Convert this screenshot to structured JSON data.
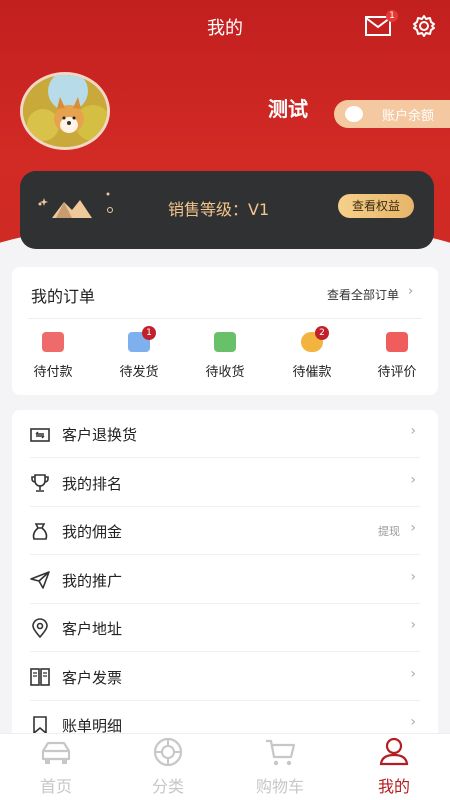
{
  "header": {
    "title": "我的",
    "mail_badge": "1",
    "username": "测试",
    "balance_label": "账户余额"
  },
  "level": {
    "text": "销售等级：V1",
    "benefits_button": "查看权益"
  },
  "orders": {
    "title": "我的订单",
    "view_all": "查看全部订单",
    "items": [
      {
        "label": "待付款",
        "badge": "",
        "color": "#ef6a6a",
        "icon": "payment-icon"
      },
      {
        "label": "待发货",
        "badge": "1",
        "color": "#7fb0ee",
        "icon": "shipping-box-icon"
      },
      {
        "label": "待收货",
        "badge": "",
        "color": "#69c06a",
        "icon": "truck-icon"
      },
      {
        "label": "待催款",
        "badge": "2",
        "color": "#f3b33f",
        "icon": "yen-coin-icon"
      },
      {
        "label": "待评价",
        "badge": "",
        "color": "#ef5d5d",
        "icon": "review-icon"
      }
    ]
  },
  "menu": {
    "items": [
      {
        "label": "客户退换货",
        "extra": "",
        "icon": "return-exchange-icon"
      },
      {
        "label": "我的排名",
        "extra": "",
        "icon": "trophy-icon"
      },
      {
        "label": "我的佣金",
        "extra": "提现",
        "icon": "money-bag-icon"
      },
      {
        "label": "我的推广",
        "extra": "",
        "icon": "send-icon"
      },
      {
        "label": "客户地址",
        "extra": "",
        "icon": "location-icon"
      },
      {
        "label": "客户发票",
        "extra": "",
        "icon": "invoice-icon"
      },
      {
        "label": "账单明细",
        "extra": "",
        "icon": "bookmark-icon"
      }
    ]
  },
  "tabs": [
    {
      "label": "首页",
      "icon": "car-icon",
      "active": false
    },
    {
      "label": "分类",
      "icon": "category-wheel-icon",
      "active": false
    },
    {
      "label": "购物车",
      "icon": "cart-icon",
      "active": false
    },
    {
      "label": "我的",
      "icon": "user-icon",
      "active": true
    }
  ],
  "colors": {
    "brand_red": "#c21f1f",
    "active_tab": "#b31e22",
    "level_card": "#303133",
    "gold": "#f3c58a"
  }
}
